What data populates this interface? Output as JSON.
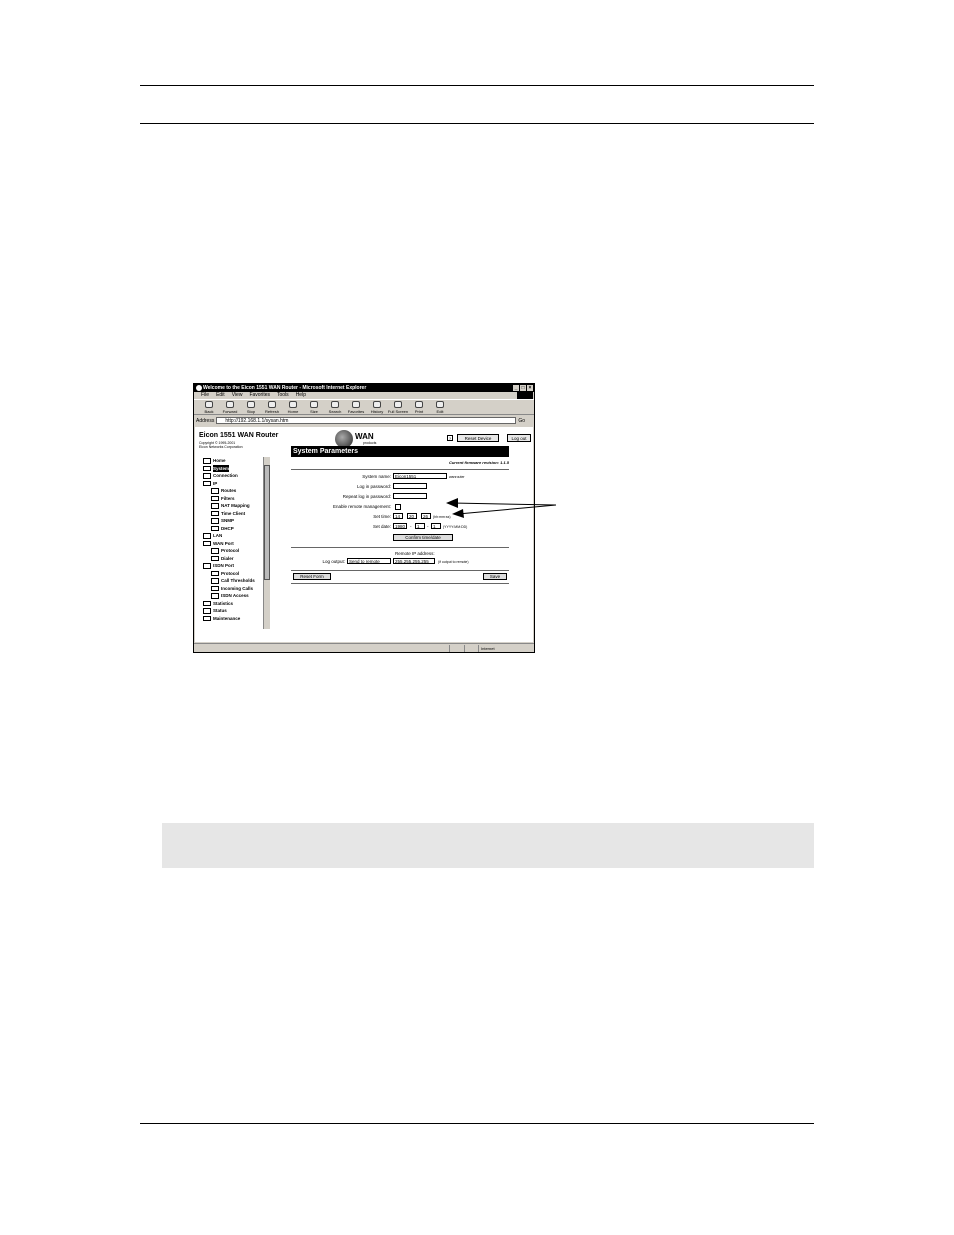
{
  "window": {
    "title": "Welcome to the Eicon 1551 WAN Router - Microsoft Internet Explorer",
    "controls": [
      "_",
      "□",
      "×"
    ]
  },
  "menu": [
    "File",
    "Edit",
    "View",
    "Favorites",
    "Tools",
    "Help"
  ],
  "toolbar": [
    "Back",
    "Forward",
    "Stop",
    "Refresh",
    "Home",
    "Size",
    "Search",
    "Favorites",
    "History",
    "Full Screen",
    "Print",
    "Edit"
  ],
  "address": {
    "label": "Address",
    "value": "http://192.168.1.1/sysan.htm",
    "go": "Go"
  },
  "header": {
    "brand": "Eicon 1551 WAN Router",
    "copyright": "Copyright © 1995-2001",
    "company": "Eicon Networks Corporation",
    "logo_main": "WAN",
    "logo_sub": "products",
    "help": "?",
    "reset_device": "Reset Device",
    "log_out": "Log out"
  },
  "tree": [
    {
      "label": "Home",
      "indent": 0
    },
    {
      "label": "System",
      "indent": 0
    },
    {
      "label": "Connection",
      "indent": 0
    },
    {
      "label": "IP",
      "indent": 0
    },
    {
      "label": "Routes",
      "indent": 1
    },
    {
      "label": "Filters",
      "indent": 1
    },
    {
      "label": "NAT Mapping",
      "indent": 1
    },
    {
      "label": "Time Client",
      "indent": 1
    },
    {
      "label": "SNMP",
      "indent": 1
    },
    {
      "label": "DHCP",
      "indent": 1
    },
    {
      "label": "LAN",
      "indent": 0
    },
    {
      "label": "WAN Port",
      "indent": 0
    },
    {
      "label": "Protocol",
      "indent": 1
    },
    {
      "label": "Dialer",
      "indent": 1
    },
    {
      "label": "ISDN Port",
      "indent": 0
    },
    {
      "label": "Protocol",
      "indent": 1
    },
    {
      "label": "Call Thresholds",
      "indent": 1
    },
    {
      "label": "Incoming Calls",
      "indent": 1
    },
    {
      "label": "ISDN Access",
      "indent": 1
    },
    {
      "label": "Statistics",
      "indent": 0
    },
    {
      "label": "Status",
      "indent": 0
    },
    {
      "label": "Maintenance",
      "indent": 0
    }
  ],
  "form": {
    "title": "System Parameters",
    "firmware": "Current firmware revision: 1.1.5",
    "system_name_label": "System name:",
    "system_name_value": "Eicon1551",
    "system_name_suffix": "wanrouter",
    "login_password_label": "Log in password:",
    "repeat_password_label": "Repeat log in password:",
    "remote_mgmt_label": "Enable remote management:",
    "set_time_label": "Set time:",
    "time_h": "14",
    "time_m": "20",
    "time_s": "26",
    "time_format": "(hh:mm:ss)",
    "set_date_label": "Set date:",
    "date_y": "1980",
    "date_m": "1",
    "date_d": "1",
    "date_format": "(YYYY:MM:DD)",
    "date_sep": "-",
    "confirm_button": "Confirm time/date",
    "remote_ip_label": "Remote IP address:",
    "log_output_label": "Log output:",
    "log_output_value": "Send to remote",
    "remote_ip_value": "255.255.255.255",
    "remote_ip_note": "(if output to remote)",
    "reset_form": "Reset Form",
    "save": "Save"
  },
  "status": {
    "zone": "Internet"
  }
}
